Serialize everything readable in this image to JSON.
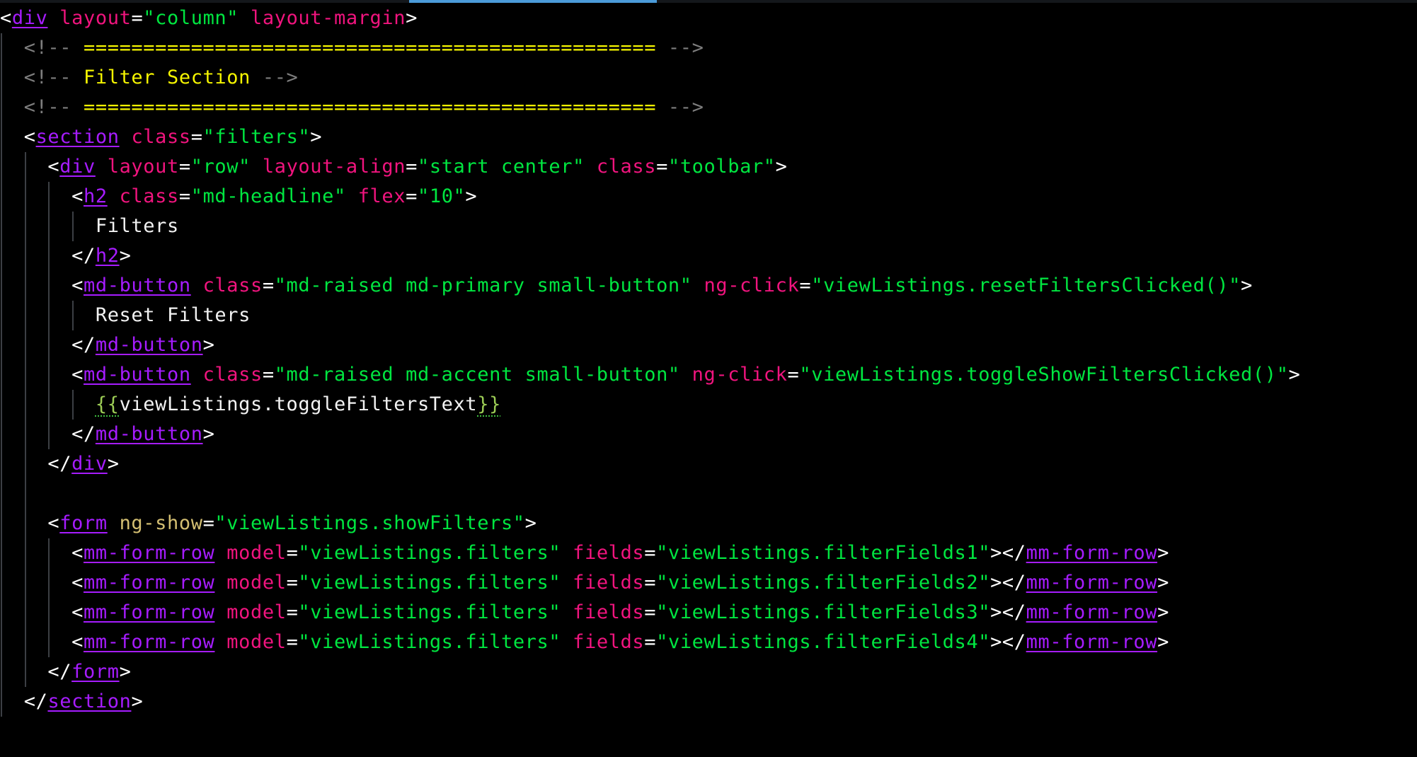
{
  "editor": {
    "theme": {
      "background": "#000000",
      "tag": "#a61cff",
      "attribute": "#f0147e",
      "directive_attribute": "#d4bf72",
      "string": "#00e640",
      "text": "#f2f2f2",
      "comment": "#f5f500",
      "comment_delimiter": "#7d7d7d",
      "interpolation_brace": "#9ccc55",
      "scrollbar_thumb": "#4b9bd9"
    },
    "lines": [
      {
        "indent": 0,
        "guides": [],
        "tokens": [
          {
            "t": "punct",
            "v": "<"
          },
          {
            "t": "tag",
            "v": "div"
          },
          {
            "t": "punct",
            "v": " "
          },
          {
            "t": "attr",
            "v": "layout"
          },
          {
            "t": "punct",
            "v": "="
          },
          {
            "t": "str",
            "v": "\"column\""
          },
          {
            "t": "punct",
            "v": " "
          },
          {
            "t": "attr",
            "v": "layout-margin"
          },
          {
            "t": "punct",
            "v": ">"
          }
        ]
      },
      {
        "indent": 2,
        "guides": [
          0
        ],
        "tokens": [
          {
            "t": "comment-delim",
            "v": "<!--"
          },
          {
            "t": "punct",
            "v": " "
          },
          {
            "t": "comment",
            "v": "================================================"
          },
          {
            "t": "punct",
            "v": " "
          },
          {
            "t": "comment-delim",
            "v": "-->"
          }
        ]
      },
      {
        "indent": 2,
        "guides": [
          0
        ],
        "tokens": [
          {
            "t": "comment-delim",
            "v": "<!--"
          },
          {
            "t": "punct",
            "v": " "
          },
          {
            "t": "comment",
            "v": "Filter Section"
          },
          {
            "t": "punct",
            "v": " "
          },
          {
            "t": "comment-delim",
            "v": "-->"
          }
        ]
      },
      {
        "indent": 2,
        "guides": [
          0
        ],
        "tokens": [
          {
            "t": "comment-delim",
            "v": "<!--"
          },
          {
            "t": "punct",
            "v": " "
          },
          {
            "t": "comment",
            "v": "================================================"
          },
          {
            "t": "punct",
            "v": " "
          },
          {
            "t": "comment-delim",
            "v": "-->"
          }
        ]
      },
      {
        "indent": 2,
        "guides": [
          0
        ],
        "tokens": [
          {
            "t": "punct",
            "v": "<"
          },
          {
            "t": "tag",
            "v": "section"
          },
          {
            "t": "punct",
            "v": " "
          },
          {
            "t": "attr",
            "v": "class"
          },
          {
            "t": "punct",
            "v": "="
          },
          {
            "t": "str",
            "v": "\"filters\""
          },
          {
            "t": "punct",
            "v": ">"
          }
        ]
      },
      {
        "indent": 4,
        "guides": [
          0,
          2
        ],
        "tokens": [
          {
            "t": "punct",
            "v": "<"
          },
          {
            "t": "tag",
            "v": "div"
          },
          {
            "t": "punct",
            "v": " "
          },
          {
            "t": "attr",
            "v": "layout"
          },
          {
            "t": "punct",
            "v": "="
          },
          {
            "t": "str",
            "v": "\"row\""
          },
          {
            "t": "punct",
            "v": " "
          },
          {
            "t": "attr",
            "v": "layout-align"
          },
          {
            "t": "punct",
            "v": "="
          },
          {
            "t": "str",
            "v": "\"start center\""
          },
          {
            "t": "punct",
            "v": " "
          },
          {
            "t": "attr",
            "v": "class"
          },
          {
            "t": "punct",
            "v": "="
          },
          {
            "t": "str",
            "v": "\"toolbar\""
          },
          {
            "t": "punct",
            "v": ">"
          }
        ]
      },
      {
        "indent": 6,
        "guides": [
          0,
          2,
          4
        ],
        "tokens": [
          {
            "t": "punct",
            "v": "<"
          },
          {
            "t": "tag",
            "v": "h2"
          },
          {
            "t": "punct",
            "v": " "
          },
          {
            "t": "attr",
            "v": "class"
          },
          {
            "t": "punct",
            "v": "="
          },
          {
            "t": "str",
            "v": "\"md-headline\""
          },
          {
            "t": "punct",
            "v": " "
          },
          {
            "t": "attr",
            "v": "flex"
          },
          {
            "t": "punct",
            "v": "="
          },
          {
            "t": "str",
            "v": "\"10\""
          },
          {
            "t": "punct",
            "v": ">"
          }
        ]
      },
      {
        "indent": 8,
        "guides": [
          0,
          2,
          4,
          6
        ],
        "tokens": [
          {
            "t": "text",
            "v": "Filters"
          }
        ]
      },
      {
        "indent": 6,
        "guides": [
          0,
          2,
          4
        ],
        "tokens": [
          {
            "t": "punct",
            "v": "</"
          },
          {
            "t": "tag",
            "v": "h2"
          },
          {
            "t": "punct",
            "v": ">"
          }
        ]
      },
      {
        "indent": 6,
        "guides": [
          0,
          2,
          4
        ],
        "tokens": [
          {
            "t": "punct",
            "v": "<"
          },
          {
            "t": "tag",
            "v": "md-button"
          },
          {
            "t": "punct",
            "v": " "
          },
          {
            "t": "attr",
            "v": "class"
          },
          {
            "t": "punct",
            "v": "="
          },
          {
            "t": "str",
            "v": "\"md-raised md-primary small-button\""
          },
          {
            "t": "punct",
            "v": " "
          },
          {
            "t": "attr",
            "v": "ng-click"
          },
          {
            "t": "punct",
            "v": "="
          },
          {
            "t": "str",
            "v": "\"viewListings.resetFiltersClicked()\""
          },
          {
            "t": "punct",
            "v": ">"
          }
        ]
      },
      {
        "indent": 8,
        "guides": [
          0,
          2,
          4,
          6
        ],
        "tokens": [
          {
            "t": "text",
            "v": "Reset Filters"
          }
        ]
      },
      {
        "indent": 6,
        "guides": [
          0,
          2,
          4
        ],
        "tokens": [
          {
            "t": "punct",
            "v": "</"
          },
          {
            "t": "tag",
            "v": "md-button"
          },
          {
            "t": "punct",
            "v": ">"
          }
        ]
      },
      {
        "indent": 6,
        "guides": [
          0,
          2,
          4
        ],
        "tokens": [
          {
            "t": "punct",
            "v": "<"
          },
          {
            "t": "tag",
            "v": "md-button"
          },
          {
            "t": "punct",
            "v": " "
          },
          {
            "t": "attr",
            "v": "class"
          },
          {
            "t": "punct",
            "v": "="
          },
          {
            "t": "str",
            "v": "\"md-raised md-accent small-button\""
          },
          {
            "t": "punct",
            "v": " "
          },
          {
            "t": "attr",
            "v": "ng-click"
          },
          {
            "t": "punct",
            "v": "="
          },
          {
            "t": "str",
            "v": "\"viewListings.toggleShowFiltersClicked()\""
          },
          {
            "t": "punct",
            "v": ">"
          }
        ]
      },
      {
        "indent": 8,
        "guides": [
          0,
          2,
          4,
          6
        ],
        "tokens": [
          {
            "t": "brace",
            "v": "{{"
          },
          {
            "t": "text",
            "v": "viewListings.toggleFiltersText"
          },
          {
            "t": "brace",
            "v": "}}"
          }
        ]
      },
      {
        "indent": 6,
        "guides": [
          0,
          2,
          4
        ],
        "tokens": [
          {
            "t": "punct",
            "v": "</"
          },
          {
            "t": "tag",
            "v": "md-button"
          },
          {
            "t": "punct",
            "v": ">"
          }
        ]
      },
      {
        "indent": 4,
        "guides": [
          0,
          2
        ],
        "tokens": [
          {
            "t": "punct",
            "v": "</"
          },
          {
            "t": "tag",
            "v": "div"
          },
          {
            "t": "punct",
            "v": ">"
          }
        ]
      },
      {
        "indent": 0,
        "guides": [
          0,
          2
        ],
        "tokens": []
      },
      {
        "indent": 4,
        "guides": [
          0,
          2
        ],
        "tokens": [
          {
            "t": "punct",
            "v": "<"
          },
          {
            "t": "tag",
            "v": "form"
          },
          {
            "t": "punct",
            "v": " "
          },
          {
            "t": "attr-ng",
            "v": "ng-show"
          },
          {
            "t": "punct",
            "v": "="
          },
          {
            "t": "str",
            "v": "\"viewListings.showFilters\""
          },
          {
            "t": "punct",
            "v": ">"
          }
        ]
      },
      {
        "indent": 6,
        "guides": [
          0,
          2,
          4
        ],
        "tokens": [
          {
            "t": "punct",
            "v": "<"
          },
          {
            "t": "tag",
            "v": "mm-form-row"
          },
          {
            "t": "punct",
            "v": " "
          },
          {
            "t": "attr",
            "v": "model"
          },
          {
            "t": "punct",
            "v": "="
          },
          {
            "t": "str",
            "v": "\"viewListings.filters\""
          },
          {
            "t": "punct",
            "v": " "
          },
          {
            "t": "attr",
            "v": "fields"
          },
          {
            "t": "punct",
            "v": "="
          },
          {
            "t": "str",
            "v": "\"viewListings.filterFields1\""
          },
          {
            "t": "punct",
            "v": "></"
          },
          {
            "t": "tag",
            "v": "mm-form-row"
          },
          {
            "t": "punct",
            "v": ">"
          }
        ]
      },
      {
        "indent": 6,
        "guides": [
          0,
          2,
          4
        ],
        "tokens": [
          {
            "t": "punct",
            "v": "<"
          },
          {
            "t": "tag",
            "v": "mm-form-row"
          },
          {
            "t": "punct",
            "v": " "
          },
          {
            "t": "attr",
            "v": "model"
          },
          {
            "t": "punct",
            "v": "="
          },
          {
            "t": "str",
            "v": "\"viewListings.filters\""
          },
          {
            "t": "punct",
            "v": " "
          },
          {
            "t": "attr",
            "v": "fields"
          },
          {
            "t": "punct",
            "v": "="
          },
          {
            "t": "str",
            "v": "\"viewListings.filterFields2\""
          },
          {
            "t": "punct",
            "v": "></"
          },
          {
            "t": "tag",
            "v": "mm-form-row"
          },
          {
            "t": "punct",
            "v": ">"
          }
        ]
      },
      {
        "indent": 6,
        "guides": [
          0,
          2,
          4
        ],
        "tokens": [
          {
            "t": "punct",
            "v": "<"
          },
          {
            "t": "tag",
            "v": "mm-form-row"
          },
          {
            "t": "punct",
            "v": " "
          },
          {
            "t": "attr",
            "v": "model"
          },
          {
            "t": "punct",
            "v": "="
          },
          {
            "t": "str",
            "v": "\"viewListings.filters\""
          },
          {
            "t": "punct",
            "v": " "
          },
          {
            "t": "attr",
            "v": "fields"
          },
          {
            "t": "punct",
            "v": "="
          },
          {
            "t": "str",
            "v": "\"viewListings.filterFields3\""
          },
          {
            "t": "punct",
            "v": "></"
          },
          {
            "t": "tag",
            "v": "mm-form-row"
          },
          {
            "t": "punct",
            "v": ">"
          }
        ]
      },
      {
        "indent": 6,
        "guides": [
          0,
          2,
          4
        ],
        "tokens": [
          {
            "t": "punct",
            "v": "<"
          },
          {
            "t": "tag",
            "v": "mm-form-row"
          },
          {
            "t": "punct",
            "v": " "
          },
          {
            "t": "attr",
            "v": "model"
          },
          {
            "t": "punct",
            "v": "="
          },
          {
            "t": "str",
            "v": "\"viewListings.filters\""
          },
          {
            "t": "punct",
            "v": " "
          },
          {
            "t": "attr",
            "v": "fields"
          },
          {
            "t": "punct",
            "v": "="
          },
          {
            "t": "str",
            "v": "\"viewListings.filterFields4\""
          },
          {
            "t": "punct",
            "v": "></"
          },
          {
            "t": "tag",
            "v": "mm-form-row"
          },
          {
            "t": "punct",
            "v": ">"
          }
        ]
      },
      {
        "indent": 4,
        "guides": [
          0,
          2
        ],
        "tokens": [
          {
            "t": "punct",
            "v": "</"
          },
          {
            "t": "tag",
            "v": "form"
          },
          {
            "t": "punct",
            "v": ">"
          }
        ]
      },
      {
        "indent": 2,
        "guides": [
          0
        ],
        "tokens": [
          {
            "t": "punct",
            "v": "</"
          },
          {
            "t": "tag",
            "v": "section"
          },
          {
            "t": "punct",
            "v": ">"
          }
        ]
      }
    ]
  }
}
